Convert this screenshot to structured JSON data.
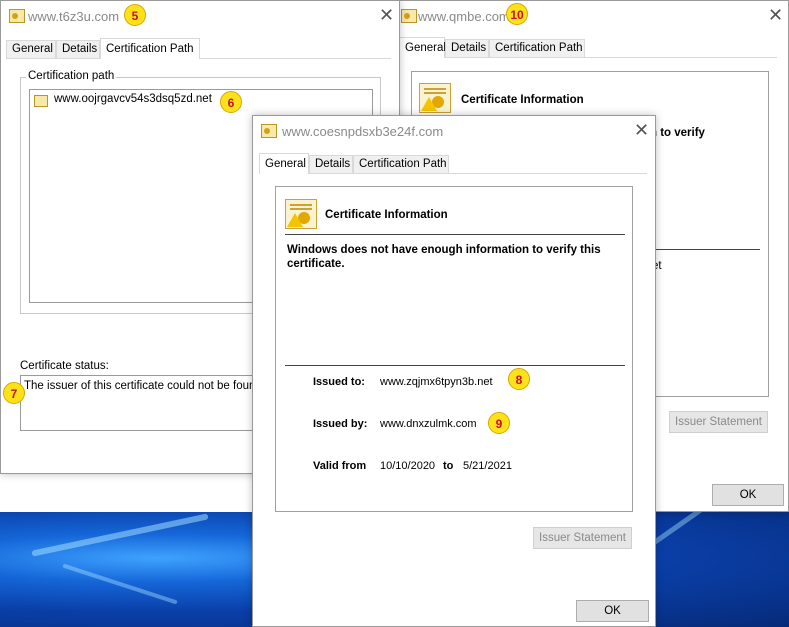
{
  "desktop": {},
  "win_back_right": {
    "title": "www.qmbe.com",
    "badge": "10",
    "tabs": [
      "General",
      "Details",
      "Certification Path"
    ],
    "cert_info_heading": "Certificate Information",
    "partial_line1": "n to verify",
    "partial_line2": "et",
    "issuer_statement": "Issuer Statement",
    "ok": "OK"
  },
  "win_back_left": {
    "title": "www.t6z3u.com",
    "badge": "5",
    "tabs": [
      "General",
      "Details",
      "Certification Path"
    ],
    "cert_path_label": "Certification path",
    "path_item": "www.oojrgavcv54s3dsq5zd.net",
    "path_badge": "6",
    "status_label": "Certificate status:",
    "status_text": "The issuer of this certificate could not be found.",
    "status_badge": "7"
  },
  "win_front": {
    "title": "www.coesnpdsxb3e24f.com",
    "tabs": [
      "General",
      "Details",
      "Certification Path"
    ],
    "cert_info_heading": "Certificate Information",
    "warning_text": "Windows does not have enough information to verify this certificate.",
    "issued_to_label": "Issued to:",
    "issued_to_value": "www.zqjmx6tpyn3b.net",
    "issued_to_badge": "8",
    "issued_by_label": "Issued by:",
    "issued_by_value": "www.dnxzulmk.com",
    "issued_by_badge": "9",
    "valid_from_label": "Valid from",
    "valid_from_value": "10/10/2020",
    "valid_to_label": "to",
    "valid_to_value": "5/21/2021",
    "issuer_statement": "Issuer Statement",
    "ok": "OK"
  }
}
